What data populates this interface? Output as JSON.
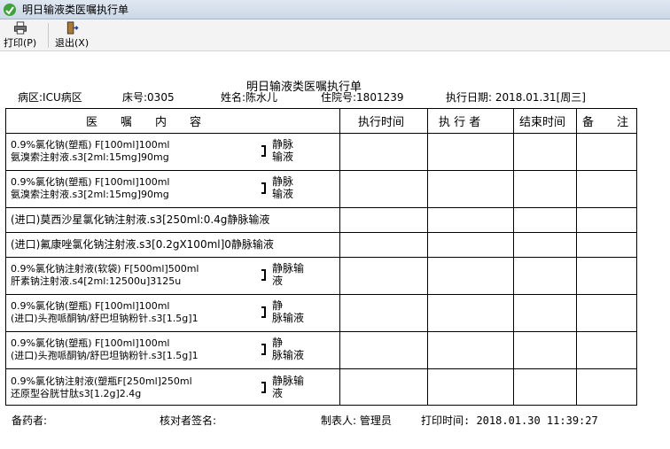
{
  "window": {
    "title": "明日输液类医嘱执行单"
  },
  "toolbar": {
    "print_label": "打印(P)",
    "exit_label": "退出(X)"
  },
  "report": {
    "title": "明日输液类医嘱执行单",
    "ward": "病区:ICU病区",
    "bed": "床号:0305",
    "name": "姓名:陈水儿",
    "admission": "住院号:1801239",
    "exec_date": "执行日期: 2018.01.31[周三]"
  },
  "columns": {
    "content": "医　　嘱　　内　　容",
    "exec_time": "执行时间",
    "executor": "执 行 者",
    "end_time": "结束时间",
    "remark": "备　　注"
  },
  "orders": [
    {
      "line1": "0.9%氯化钠(塑瓶) F[100ml]100ml",
      "line2": "氨溴索注射液.s3[2ml:15mg]90mg",
      "route1": "静脉",
      "route2": "输液"
    },
    {
      "line1": "0.9%氯化钠(塑瓶) F[100ml]100ml",
      "line2": "氨溴索注射液.s3[2ml:15mg]90mg",
      "route1": "静脉",
      "route2": "输液"
    },
    {
      "line1": "(进口)莫西沙星氯化钠注射液.s3[250ml:0.4g静脉输液"
    },
    {
      "line1": "(进口)氟康唑氯化钠注射液.s3[0.2gX100ml]0静脉输液"
    },
    {
      "line1": "0.9%氯化钠注射液(软袋) F[500ml]500ml",
      "line2": "肝素钠注射液.s4[2ml:12500u]3125u",
      "route1": "静脉输",
      "route2": "液"
    },
    {
      "line1": "0.9%氯化钠(塑瓶) F[100ml]100ml",
      "line2": "(进口)头孢哌酮钠/舒巴坦钠粉针.s3[1.5g]1",
      "route1": "静",
      "route2": "脉输液"
    },
    {
      "line1": "0.9%氯化钠(塑瓶) F[100ml]100ml",
      "line2": "(进口)头孢哌酮钠/舒巴坦钠粉针.s3[1.5g]1",
      "route1": "静",
      "route2": "脉输液"
    },
    {
      "line1": "0.9%氯化钠注射液(塑瓶F[250ml]250ml",
      "line2": "还原型谷胱甘肽s3[1.2g]2.4g",
      "route1": "静脉输",
      "route2": "液"
    }
  ],
  "footer": {
    "pharmacist": "备药者:",
    "checker": "核对者签名:",
    "maker": "制表人: 管理员",
    "print_time": "打印时间:  2018.01.30   11:39:27"
  }
}
